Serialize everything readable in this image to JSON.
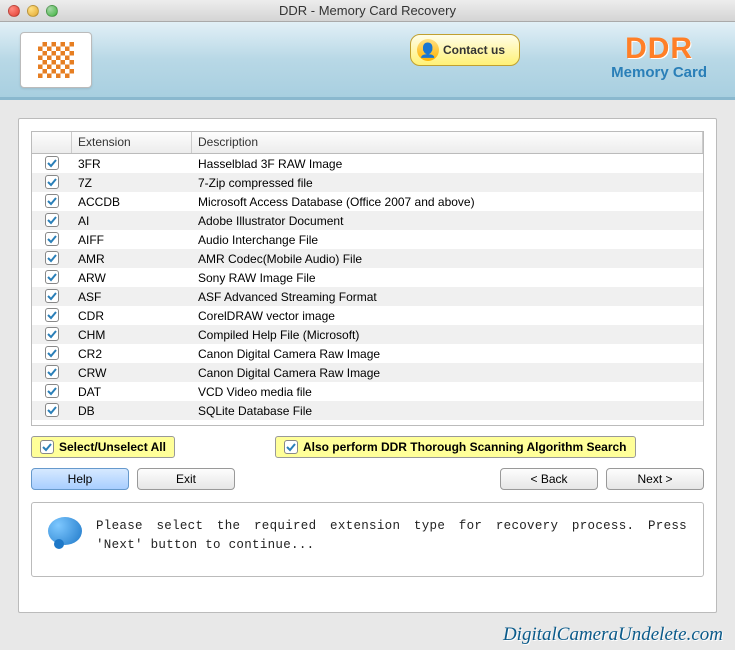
{
  "window": {
    "title": "DDR - Memory Card Recovery"
  },
  "header": {
    "contact_label": "Contact us",
    "brand": "DDR",
    "brand_sub": "Memory Card"
  },
  "table": {
    "headers": {
      "ext": "Extension",
      "desc": "Description"
    },
    "rows": [
      {
        "ext": "3FR",
        "desc": "Hasselblad 3F RAW Image",
        "checked": true
      },
      {
        "ext": "7Z",
        "desc": "7-Zip compressed file",
        "checked": true
      },
      {
        "ext": "ACCDB",
        "desc": "Microsoft Access Database (Office 2007 and above)",
        "checked": true
      },
      {
        "ext": "AI",
        "desc": "Adobe Illustrator Document",
        "checked": true
      },
      {
        "ext": "AIFF",
        "desc": "Audio Interchange File",
        "checked": true
      },
      {
        "ext": "AMR",
        "desc": "AMR Codec(Mobile Audio) File",
        "checked": true
      },
      {
        "ext": "ARW",
        "desc": "Sony RAW Image File",
        "checked": true
      },
      {
        "ext": "ASF",
        "desc": "ASF Advanced Streaming Format",
        "checked": true
      },
      {
        "ext": "CDR",
        "desc": "CorelDRAW vector image",
        "checked": true
      },
      {
        "ext": "CHM",
        "desc": "Compiled Help File (Microsoft)",
        "checked": true
      },
      {
        "ext": "CR2",
        "desc": "Canon Digital Camera Raw Image",
        "checked": true
      },
      {
        "ext": "CRW",
        "desc": "Canon Digital Camera Raw Image",
        "checked": true
      },
      {
        "ext": "DAT",
        "desc": "VCD Video media file",
        "checked": true
      },
      {
        "ext": "DB",
        "desc": "SQLite Database File",
        "checked": true
      }
    ]
  },
  "options": {
    "select_all": "Select/Unselect All",
    "thorough": "Also perform DDR Thorough Scanning Algorithm Search"
  },
  "buttons": {
    "help": "Help",
    "exit": "Exit",
    "back": "< Back",
    "next": "Next >"
  },
  "info": "Please select the required extension type for recovery process. Press 'Next' button to continue...",
  "footer": "DigitalCameraUndelete.com"
}
